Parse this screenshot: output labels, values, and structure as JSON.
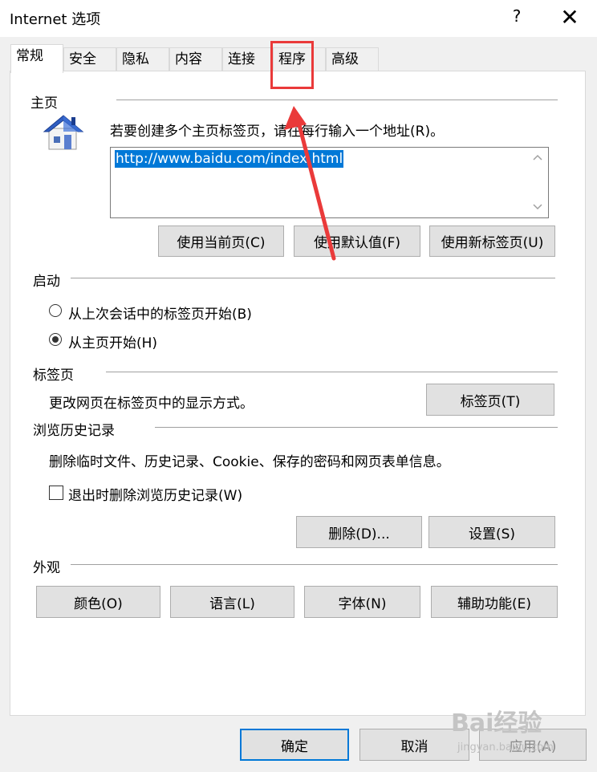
{
  "window": {
    "title": "Internet 选项",
    "help": "?",
    "close": "✕"
  },
  "tabs": [
    "常规",
    "安全",
    "隐私",
    "内容",
    "连接",
    "程序",
    "高级"
  ],
  "homepage": {
    "heading": "主页",
    "instruction": "若要创建多个主页标签页，请在每行输入一个地址(R)。",
    "url": "http://www.baidu.com/index.html",
    "buttons": [
      "使用当前页(C)",
      "使用默认值(F)",
      "使用新标签页(U)"
    ]
  },
  "startup": {
    "heading": "启动",
    "options": [
      "从上次会话中的标签页开始(B)",
      "从主页开始(H)"
    ],
    "selected_index": 1
  },
  "tabs_section": {
    "heading": "标签页",
    "description": "更改网页在标签页中的显示方式。",
    "button": "标签页(T)"
  },
  "history": {
    "heading": "浏览历史记录",
    "description": "删除临时文件、历史记录、Cookie、保存的密码和网页表单信息。",
    "checkbox_label": "退出时删除浏览历史记录(W)",
    "checkbox_checked": false,
    "delete_button": "删除(D)...",
    "settings_button": "设置(S)"
  },
  "appearance": {
    "heading": "外观",
    "buttons": [
      "颜色(O)",
      "语言(L)",
      "字体(N)",
      "辅助功能(E)"
    ]
  },
  "footer": {
    "ok": "确定",
    "cancel": "取消",
    "apply": "应用(A)"
  },
  "watermark": {
    "brand": "Bai经验",
    "url": "jingyan.baidu.com"
  },
  "colors": {
    "accent": "#0078d7",
    "annotation": "#ea3a3a"
  }
}
